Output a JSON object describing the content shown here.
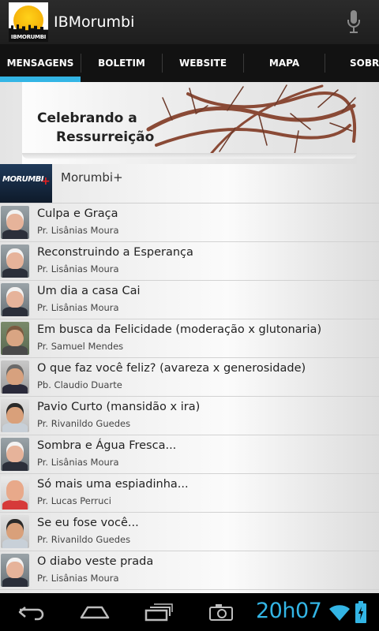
{
  "app": {
    "title": "IBMorumbi",
    "logo_text": "IBMORUMBI"
  },
  "tabs": [
    {
      "label": "MENSAGENS",
      "selected": true
    },
    {
      "label": "BOLETIM"
    },
    {
      "label": "WEBSITE"
    },
    {
      "label": "MAPA"
    },
    {
      "label": "SOBRE"
    }
  ],
  "banner": {
    "line1": "Celebrando a",
    "line2": "Ressurreição"
  },
  "featured": {
    "thumb_text": "MORUMBI",
    "thumb_plus": "+",
    "title": "Morumbi+"
  },
  "messages": [
    {
      "title": "Culpa e Graça",
      "speaker": "Pr. Lisânias Moura",
      "avatar": "white-hair"
    },
    {
      "title": "Reconstruindo a Esperança",
      "speaker": "Pr. Lisânias Moura",
      "avatar": "white-hair"
    },
    {
      "title": "Um dia a casa Cai",
      "speaker": "Pr. Lisânias Moura",
      "avatar": "white-hair"
    },
    {
      "title": "Em busca da Felicidade (moderação x glutonaria)",
      "speaker": "Pr. Samuel Mendes",
      "avatar": "beard"
    },
    {
      "title": "O que faz você feliz? (avareza x generosidade)",
      "speaker": "Pb. Claudio Duarte",
      "avatar": "suit"
    },
    {
      "title": "Pavio Curto (mansidão x ira)",
      "speaker": "Pr. Rivanildo Guedes",
      "avatar": "glasses"
    },
    {
      "title": "Sombra e Água Fresca...",
      "speaker": "Pr. Lisânias Moura",
      "avatar": "white-hair"
    },
    {
      "title": "Só mais uma espiadinha...",
      "speaker": "Pr. Lucas Perruci",
      "avatar": "bald"
    },
    {
      "title": "Se eu fose você...",
      "speaker": "Pr. Rivanildo Guedes",
      "avatar": "glasses"
    },
    {
      "title": "O diabo veste prada",
      "speaker": "Pr. Lisânias Moura",
      "avatar": "white-hair"
    }
  ],
  "system": {
    "clock": "20h07"
  },
  "colors": {
    "accent": "#33b5e5",
    "actionbar": "#232323",
    "tabbar": "#121212"
  },
  "icons": [
    "mic-icon",
    "back-icon",
    "home-icon",
    "recent-apps-icon",
    "screenshot-icon",
    "wifi-icon",
    "battery-icon"
  ]
}
